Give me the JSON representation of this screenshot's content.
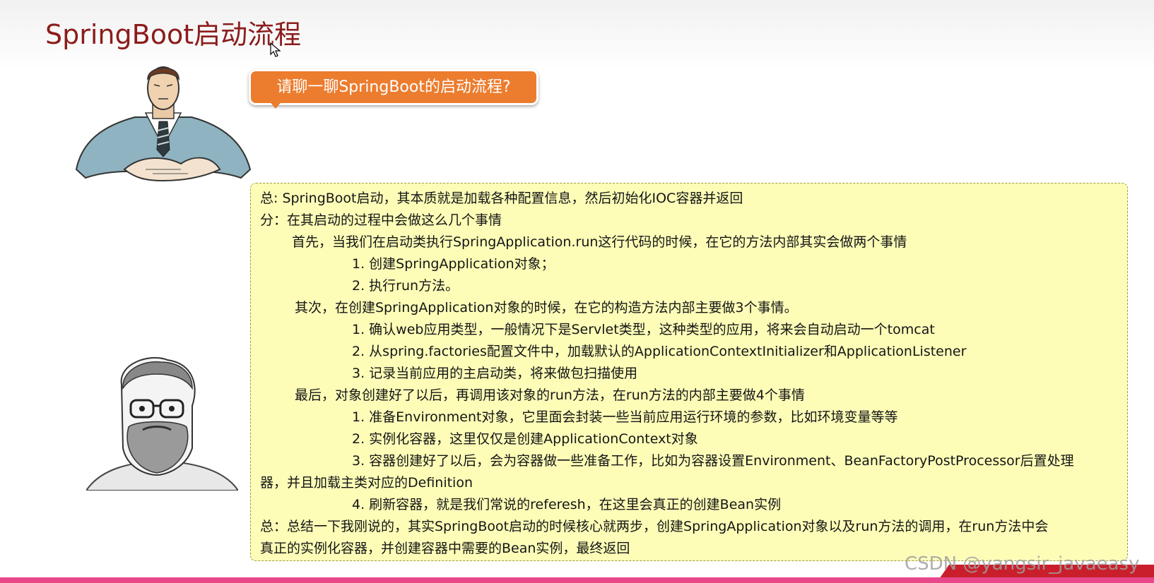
{
  "slide": {
    "title": "SpringBoot启动流程"
  },
  "question": {
    "text": "请聊一聊SpringBoot的启动流程?"
  },
  "answer": {
    "lines": [
      "总: SpringBoot启动，其本质就是加载各种配置信息，然后初始化IOC容器并返回",
      "分：在其启动的过程中会做这么几个事情",
      "首先，当我们在启动类执行SpringApplication.run这行代码的时候，在它的方法内部其实会做两个事情",
      "1. 创建SpringApplication对象；",
      "2. 执行run方法。",
      "其次，在创建SpringApplication对象的时候，在它的构造方法内部主要做3个事情。",
      "1. 确认web应用类型，一般情况下是Servlet类型，这种类型的应用，将来会自动启动一个tomcat",
      "2. 从spring.factories配置文件中，加载默认的ApplicationContextInitializer和ApplicationListener",
      "3. 记录当前应用的主启动类，将来做包扫描使用",
      "最后，对象创建好了以后，再调用该对象的run方法，在run方法的内部主要做4个事情",
      "1. 准备Environment对象，它里面会封装一些当前应用运行环境的参数，比如环境变量等等",
      "2. 实例化容器，这里仅仅是创建ApplicationContext对象",
      "3. 容器创建好了以后，会为容器做一些准备工作，比如为容器设置Environment、BeanFactoryPostProcessor后置处理",
      "器，并且加载主类对应的Definition",
      "4. 刷新容器，就是我们常说的referesh，在这里会真正的创建Bean实例",
      "总：总结一下我刚说的，其实SpringBoot启动的时候核心就两步，创建SpringApplication对象以及run方法的调用，在run方法中会",
      "真正的实例化容器，并创建容器中需要的Bean实例，最终返回"
    ]
  },
  "watermark": {
    "text": "CSDN @yangsir_javaeasy"
  }
}
